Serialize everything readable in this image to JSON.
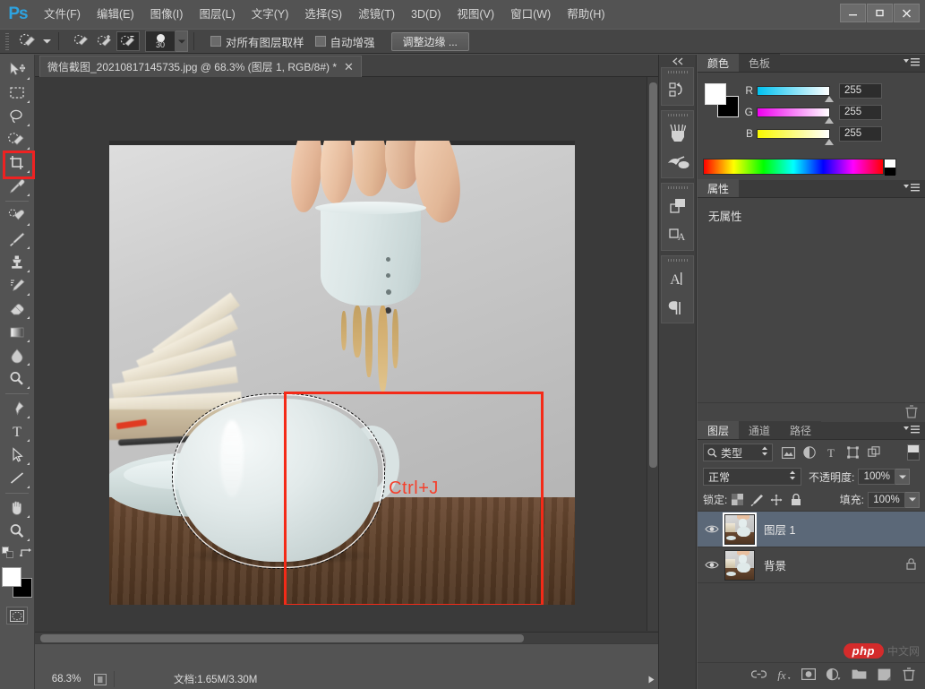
{
  "app": {
    "logo": "Ps",
    "title_tab": "微信截图_20210817145735.jpg @ 68.3% (图层 1, RGB/8#) *"
  },
  "menubar": {
    "items": [
      {
        "label": "文件(F)",
        "name": "menu-file"
      },
      {
        "label": "编辑(E)",
        "name": "menu-edit"
      },
      {
        "label": "图像(I)",
        "name": "menu-image"
      },
      {
        "label": "图层(L)",
        "name": "menu-layer"
      },
      {
        "label": "文字(Y)",
        "name": "menu-type"
      },
      {
        "label": "选择(S)",
        "name": "menu-select"
      },
      {
        "label": "滤镜(T)",
        "name": "menu-filter"
      },
      {
        "label": "3D(D)",
        "name": "menu-3d"
      },
      {
        "label": "视图(V)",
        "name": "menu-view"
      },
      {
        "label": "窗口(W)",
        "name": "menu-window"
      },
      {
        "label": "帮助(H)",
        "name": "menu-help"
      }
    ],
    "window_controls": {
      "minimize": "minimize-icon",
      "maximize": "maximize-icon",
      "close": "close-icon"
    }
  },
  "options_bar": {
    "tool_icon": "quick-selection-tool-icon",
    "modes": [
      {
        "name": "selection-new",
        "active": false
      },
      {
        "name": "selection-add",
        "active": false
      },
      {
        "name": "selection-subtract",
        "active": true
      }
    ],
    "brush_size": "30",
    "sample_all_layers": {
      "label": "对所有图层取样",
      "checked": false
    },
    "auto_enhance": {
      "label": "自动增强",
      "checked": false
    },
    "refine_edge_button": "调整边缘 ..."
  },
  "toolbar": {
    "tools": [
      {
        "name": "move-tool-icon"
      },
      {
        "name": "rectangular-marquee-tool-icon"
      },
      {
        "name": "lasso-tool-icon"
      },
      {
        "name": "quick-selection-tool-icon",
        "highlighted": true
      },
      {
        "name": "crop-tool-icon"
      },
      {
        "name": "eyedropper-tool-icon"
      },
      {
        "name": "spot-healing-brush-tool-icon"
      },
      {
        "name": "brush-tool-icon"
      },
      {
        "name": "clone-stamp-tool-icon"
      },
      {
        "name": "history-brush-tool-icon"
      },
      {
        "name": "eraser-tool-icon"
      },
      {
        "name": "gradient-tool-icon"
      },
      {
        "name": "blur-tool-icon"
      },
      {
        "name": "dodge-tool-icon"
      },
      {
        "name": "pen-tool-icon"
      },
      {
        "name": "horizontal-type-tool-icon"
      },
      {
        "name": "path-selection-tool-icon"
      },
      {
        "name": "line-tool-icon"
      },
      {
        "name": "hand-tool-icon"
      },
      {
        "name": "zoom-tool-icon"
      }
    ],
    "foreground_color": "#ffffff",
    "background_color": "#000000",
    "quick_mask_icon": "quick-mask-icon"
  },
  "canvas": {
    "annotation_text": "Ctrl+J",
    "annotation_color": "#f4412d",
    "selection_active": true,
    "image_subject": "hand pouring tea from porcelain strainer into ceramic mug on wooden table with open book and saucer"
  },
  "statusbar": {
    "zoom": "68.3%",
    "doc_info": "文档:1.65M/3.30M",
    "expand_icon": "triangle-right-icon"
  },
  "icon_dock": {
    "collapse_icon": "double-chevron-left-icon",
    "groups": [
      {
        "buttons": [
          {
            "name": "history-panel-icon"
          }
        ]
      },
      {
        "buttons": [
          {
            "name": "brush-presets-panel-icon"
          },
          {
            "name": "brush-panel-icon"
          }
        ]
      },
      {
        "buttons": [
          {
            "name": "layer-comps-panel-icon"
          },
          {
            "name": "adjustments-panel-icon"
          }
        ]
      },
      {
        "buttons": [
          {
            "name": "character-panel-icon"
          },
          {
            "name": "paragraph-panel-icon"
          }
        ]
      }
    ]
  },
  "color_panel": {
    "tabs": [
      {
        "label": "颜色",
        "name": "tab-color",
        "active": true
      },
      {
        "label": "色板",
        "name": "tab-swatches",
        "active": false
      }
    ],
    "menu_icon": "panel-menu-icon",
    "foreground": "#ffffff",
    "background": "#000000",
    "channels": [
      {
        "label": "R",
        "value": "255"
      },
      {
        "label": "G",
        "value": "255"
      },
      {
        "label": "B",
        "value": "255"
      }
    ]
  },
  "properties_panel": {
    "tabs": [
      {
        "label": "属性",
        "name": "tab-properties",
        "active": true
      }
    ],
    "menu_icon": "panel-menu-icon",
    "empty_text": "无属性",
    "delete_icon": "trash-icon"
  },
  "layers_panel": {
    "tabs": [
      {
        "label": "图层",
        "name": "tab-layers",
        "active": true
      },
      {
        "label": "通道",
        "name": "tab-channels",
        "active": false
      },
      {
        "label": "路径",
        "name": "tab-paths",
        "active": false
      }
    ],
    "menu_icon": "panel-menu-icon",
    "filter": {
      "search_icon": "search-icon",
      "kind_label": "类型",
      "icons": [
        {
          "name": "filter-pixel-icon"
        },
        {
          "name": "filter-adjustment-icon"
        },
        {
          "name": "filter-type-icon"
        },
        {
          "name": "filter-shape-icon"
        },
        {
          "name": "filter-smartobject-icon"
        }
      ],
      "toggle": "filter-enable-toggle"
    },
    "blend_mode": "正常",
    "opacity_label": "不透明度:",
    "opacity_value": "100%",
    "lock_label": "锁定:",
    "lock_icons": [
      {
        "name": "lock-transparent-pixels-icon"
      },
      {
        "name": "lock-image-pixels-icon"
      },
      {
        "name": "lock-position-icon"
      },
      {
        "name": "lock-all-icon"
      }
    ],
    "fill_label": "填充:",
    "fill_value": "100%",
    "layers": [
      {
        "name": "图层 1",
        "selected": true,
        "visible": true,
        "locked": false
      },
      {
        "name": "背景",
        "selected": false,
        "visible": true,
        "locked": true
      }
    ],
    "footer_buttons": [
      {
        "name": "link-layers-icon"
      },
      {
        "name": "layer-style-fx-icon"
      },
      {
        "name": "add-layer-mask-icon"
      },
      {
        "name": "new-adjustment-layer-icon"
      },
      {
        "name": "new-group-icon"
      },
      {
        "name": "new-layer-icon"
      },
      {
        "name": "delete-layer-icon"
      }
    ]
  },
  "watermark": {
    "badge": "php",
    "suffix": "中文网"
  }
}
